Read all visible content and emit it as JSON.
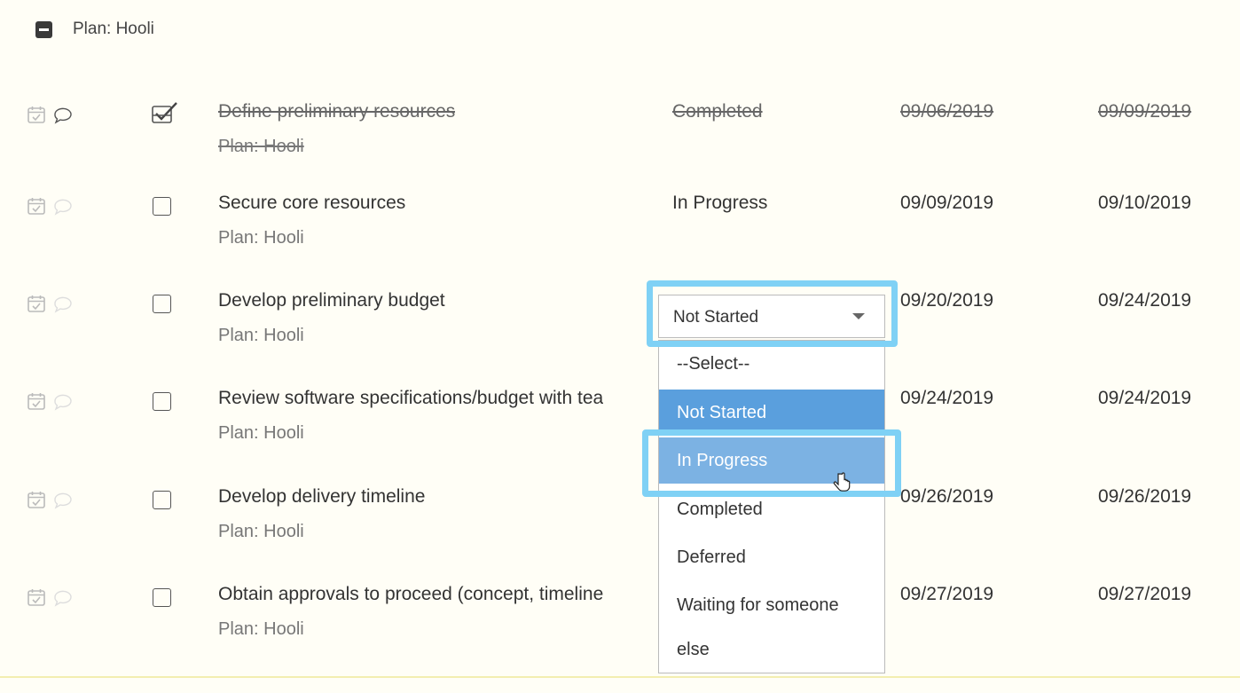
{
  "group": {
    "title": "Plan: Hooli"
  },
  "tasks": [
    {
      "title": "Define preliminary resources",
      "plan": "Plan: Hooli",
      "status": "Completed",
      "start": "09/06/2019",
      "due": "09/09/2019",
      "completed": true
    },
    {
      "title": "Secure core resources",
      "plan": "Plan: Hooli",
      "status": "In Progress",
      "start": "09/09/2019",
      "due": "09/10/2019",
      "completed": false
    },
    {
      "title": "Develop preliminary budget",
      "plan": "Plan: Hooli",
      "status": "",
      "start": "09/20/2019",
      "due": "09/24/2019",
      "completed": false
    },
    {
      "title": "Review software specifications/budget with tea",
      "plan": "Plan: Hooli",
      "status": "",
      "start": "09/24/2019",
      "due": "09/24/2019",
      "completed": false
    },
    {
      "title": "Develop delivery timeline",
      "plan": "Plan: Hooli",
      "status": "",
      "start": "09/26/2019",
      "due": "09/26/2019",
      "completed": false
    },
    {
      "title": "Obtain approvals to proceed (concept, timeline",
      "plan": "Plan: Hooli",
      "status": "",
      "start": "09/27/2019",
      "due": "09/27/2019",
      "completed": false
    }
  ],
  "status_dropdown": {
    "selected": "Not Started",
    "hovered": "In Progress",
    "options": [
      "--Select--",
      "Not Started",
      "In Progress",
      "Completed",
      "Deferred",
      "Waiting for someone",
      "else"
    ]
  },
  "icons": {
    "collapse": "collapse-minus-icon",
    "calendar": "calendar-check-icon",
    "comment": "comment-bubble-icon",
    "dropdown_arrow": "chevron-down-icon",
    "cursor": "hand-pointer-icon"
  },
  "colors": {
    "background": "#fffef6",
    "selected_option": "#5a9fdd",
    "hovered_option": "#7cb2e3",
    "annotation_highlight": "#7fd1f5"
  }
}
